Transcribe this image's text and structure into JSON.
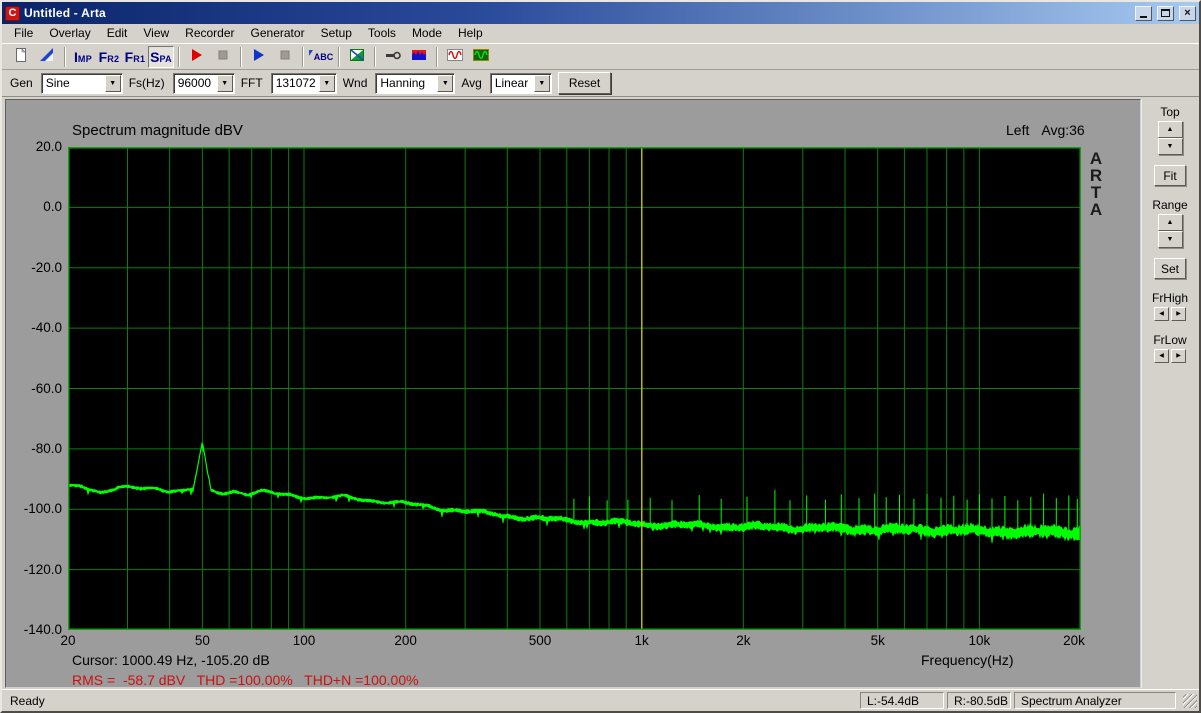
{
  "window": {
    "title": "Untitled - Arta",
    "icon": "arta-logo",
    "buttons": [
      "minimize",
      "maximize",
      "close"
    ]
  },
  "menu": {
    "items": [
      "File",
      "Overlay",
      "Edit",
      "View",
      "Recorder",
      "Generator",
      "Setup",
      "Tools",
      "Mode",
      "Help"
    ]
  },
  "toolbar": {
    "items": [
      {
        "type": "button",
        "name": "new-button",
        "icon": "new-document-icon"
      },
      {
        "type": "button",
        "name": "overlay-button",
        "icon": "overlay-icon"
      },
      {
        "type": "sep"
      },
      {
        "type": "button",
        "name": "imp-mode-button",
        "icon": "imp-text-icon",
        "text": "IMP"
      },
      {
        "type": "button",
        "name": "fr2-mode-button",
        "icon": "fr2-text-icon",
        "text": "FR2"
      },
      {
        "type": "button",
        "name": "fr1-mode-button",
        "icon": "fr1-text-icon",
        "text": "FR1"
      },
      {
        "type": "button",
        "name": "spa-mode-button",
        "icon": "spa-text-icon",
        "text": "SPA",
        "pressed": true
      },
      {
        "type": "sep"
      },
      {
        "type": "button",
        "name": "record-start-button",
        "icon": "record-play-icon"
      },
      {
        "type": "button",
        "name": "record-stop-button",
        "icon": "stop-icon",
        "disabled": true
      },
      {
        "type": "sep"
      },
      {
        "type": "button",
        "name": "generator-start-button",
        "icon": "play-icon"
      },
      {
        "type": "button",
        "name": "generator-stop-button",
        "icon": "stop-icon",
        "disabled": true
      },
      {
        "type": "sep"
      },
      {
        "type": "button",
        "name": "labels-button",
        "icon": "abc-label-icon",
        "text": "ABC"
      },
      {
        "type": "sep"
      },
      {
        "type": "button",
        "name": "spectrogram-button",
        "icon": "spectrogram-icon"
      },
      {
        "type": "sep"
      },
      {
        "type": "button",
        "name": "calibrate-button",
        "icon": "calibrate-icon"
      },
      {
        "type": "button",
        "name": "scaling-button",
        "icon": "spectrum-levels-icon"
      },
      {
        "type": "sep"
      },
      {
        "type": "button",
        "name": "signal-record-window-button",
        "icon": "scope-sine-icon"
      },
      {
        "type": "button",
        "name": "generator-setup-button",
        "icon": "generator-wave-icon"
      }
    ]
  },
  "controls": {
    "fields": [
      {
        "label": "Gen",
        "value": "Sine",
        "name": "generator-type"
      },
      {
        "label": "Fs(Hz)",
        "value": "96000",
        "name": "sampling-rate"
      },
      {
        "label": "FFT",
        "value": "131072",
        "name": "fft-size"
      },
      {
        "label": "Wnd",
        "value": "Hanning",
        "name": "window-function"
      },
      {
        "label": "Avg",
        "value": "Linear",
        "name": "averaging"
      }
    ],
    "reset_label": "Reset"
  },
  "right_panel": {
    "top_label": "Top",
    "fit_label": "Fit",
    "range_label": "Range",
    "set_label": "Set",
    "frhigh_label": "FrHigh",
    "frlow_label": "FrLow"
  },
  "status_bar": {
    "ready": "Ready",
    "left_level": "L:-54.4dB",
    "right_level": "R:-80.5dB",
    "mode": "Spectrum Analyzer"
  },
  "chart_data": {
    "type": "line",
    "title": "Spectrum magnitude dBV",
    "channel": "Left",
    "avg_text": "Avg:36",
    "watermark": "ARTA",
    "xlabel": "Frequency(Hz)",
    "x_scale": "log",
    "xlim": [
      20,
      20000
    ],
    "ylim": [
      -140,
      20
    ],
    "x_ticks": [
      "20",
      "50",
      "100",
      "200",
      "500",
      "1k",
      "2k",
      "5k",
      "10k",
      "20k"
    ],
    "x_tick_values": [
      20,
      50,
      100,
      200,
      500,
      1000,
      2000,
      5000,
      10000,
      20000
    ],
    "y_ticks": [
      "20.0",
      "0.0",
      "-20.0",
      "-40.0",
      "-60.0",
      "-80.0",
      "-100.0",
      "-120.0",
      "-140.0"
    ],
    "y_tick_values": [
      20,
      0,
      -20,
      -40,
      -60,
      -80,
      -100,
      -120,
      -140
    ],
    "grid": "log-minor-decades",
    "cursor": {
      "freq_hz": 1000.49,
      "level_db": -105.2,
      "text": "Cursor: 1000.49 Hz, -105.20 dB"
    },
    "measurements": {
      "rms_dbv": -58.7,
      "thd_pct": 100.0,
      "thdn_pct": 100.0,
      "parts": [
        "RMS =  -58.7 dBV",
        "THD =100.00%",
        "THD+N =100.00%"
      ]
    },
    "peak": {
      "freq_hz": 50,
      "level_db": -77.6
    },
    "envelope_points": [
      [
        20,
        -92.7
      ],
      [
        22,
        -92.2
      ],
      [
        25,
        -94.3
      ],
      [
        28,
        -92.9
      ],
      [
        32,
        -93.3
      ],
      [
        36,
        -93.0
      ],
      [
        40,
        -93.6
      ],
      [
        44,
        -93.9
      ],
      [
        47,
        -93.4
      ],
      [
        50,
        -77.6
      ],
      [
        53,
        -94.2
      ],
      [
        57,
        -94.6
      ],
      [
        62,
        -93.9
      ],
      [
        68,
        -94.8
      ],
      [
        75,
        -94.2
      ],
      [
        82,
        -95.0
      ],
      [
        90,
        -95.3
      ],
      [
        100,
        -95.8
      ],
      [
        115,
        -96.2
      ],
      [
        130,
        -96.0
      ],
      [
        150,
        -96.8
      ],
      [
        175,
        -97.4
      ],
      [
        200,
        -98.2
      ],
      [
        250,
        -99.6
      ],
      [
        300,
        -100.6
      ],
      [
        400,
        -102.2
      ],
      [
        500,
        -103.2
      ],
      [
        650,
        -103.9
      ],
      [
        800,
        -104.4
      ],
      [
        1000,
        -104.9
      ],
      [
        1300,
        -105.3
      ],
      [
        1700,
        -105.6
      ],
      [
        2200,
        -105.9
      ],
      [
        3000,
        -106.2
      ],
      [
        4000,
        -106.5
      ],
      [
        5000,
        -106.7
      ],
      [
        7000,
        -106.9
      ],
      [
        9000,
        -107.1
      ],
      [
        12000,
        -107.3
      ],
      [
        16000,
        -107.5
      ],
      [
        20000,
        -107.6
      ]
    ],
    "spikes": [
      [
        630,
        -96.5
      ],
      [
        700,
        -95.8
      ],
      [
        790,
        -97.0
      ],
      [
        910,
        -96.8
      ],
      [
        1060,
        -96.2
      ],
      [
        1230,
        -97.0
      ],
      [
        1480,
        -95.3
      ],
      [
        1720,
        -96.6
      ],
      [
        2050,
        -95.9
      ],
      [
        2480,
        -93.6
      ],
      [
        2750,
        -97.0
      ],
      [
        3080,
        -95.4
      ],
      [
        3500,
        -96.8
      ],
      [
        3900,
        -95.0
      ],
      [
        4400,
        -96.3
      ],
      [
        4900,
        -94.8
      ],
      [
        5300,
        -96.0
      ],
      [
        5800,
        -95.2
      ],
      [
        6400,
        -96.5
      ],
      [
        7000,
        -94.9
      ],
      [
        7700,
        -96.2
      ],
      [
        8400,
        -95.5
      ],
      [
        9200,
        -96.8
      ],
      [
        10000,
        -95.0
      ],
      [
        10900,
        -96.4
      ],
      [
        11900,
        -95.6
      ],
      [
        13000,
        -97.0
      ],
      [
        14200,
        -95.9
      ],
      [
        15500,
        -94.8
      ],
      [
        16900,
        -96.3
      ],
      [
        18400,
        -95.4
      ],
      [
        19500,
        -96.6
      ]
    ],
    "noise_halfwidth_db": [
      0.55,
      2.3
    ],
    "colors": {
      "trace": "#00ff00",
      "grid": "#0c7e0c",
      "border": "#12a012",
      "plot_bg": "#000000",
      "cursor_line": "#d6ce00",
      "panel_bg": "#9c9c9c"
    }
  }
}
